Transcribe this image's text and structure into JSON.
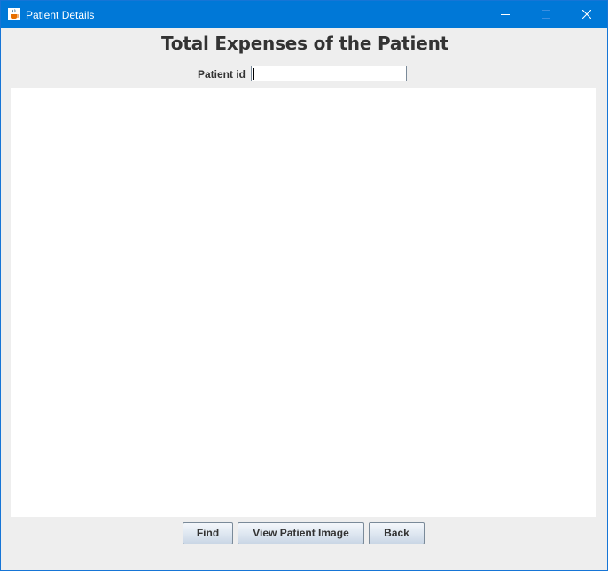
{
  "window": {
    "title": "Patient Details"
  },
  "header": {
    "title": "Total Expenses of the Patient"
  },
  "form": {
    "patient_id_label": "Patient id",
    "patient_id_value": ""
  },
  "buttons": {
    "find": "Find",
    "view_image": "View Patient Image",
    "back": "Back"
  },
  "icons": {
    "app": "java-cup-icon",
    "minimize": "minimize-icon",
    "maximize": "maximize-icon",
    "close": "close-icon"
  },
  "colors": {
    "titlebar": "#0078d7",
    "window_bg": "#eeeeee",
    "panel_bg": "#ffffff",
    "text": "#333333"
  }
}
